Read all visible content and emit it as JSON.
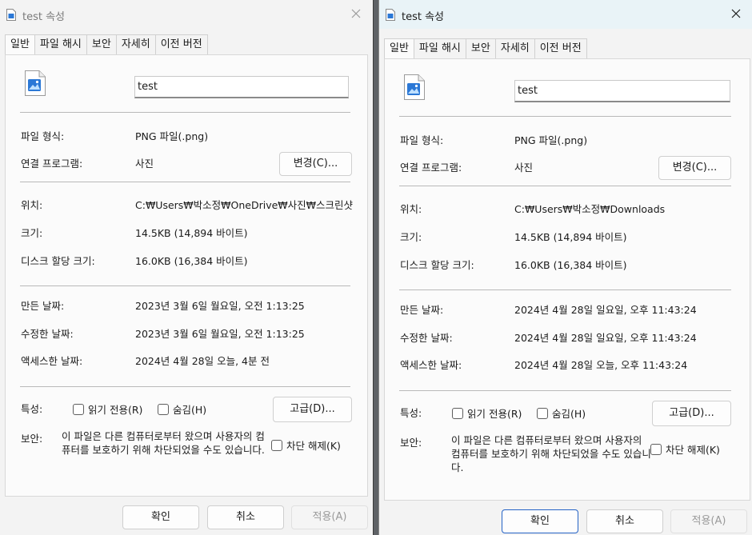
{
  "left": {
    "title": "test 속성",
    "tabs": [
      "일반",
      "파일 해시",
      "보안",
      "자세히",
      "이전 버전"
    ],
    "file_name": "test",
    "file_type_label": "파일 형식:",
    "file_type": "PNG 파일(.png)",
    "opens_with_label": "연결 프로그램:",
    "opens_with": "사진",
    "change_button": "변경(C)...",
    "location_label": "위치:",
    "location": "C:₩Users₩박소정₩OneDrive₩사진₩스크린샷",
    "size_label": "크기:",
    "size": "14.5KB (14,894 바이트)",
    "size_on_disk_label": "디스크 할당 크기:",
    "size_on_disk": "16.0KB (16,384 바이트)",
    "created_label": "만든 날짜:",
    "created": "2023년 3월 6일 월요일, 오전 1:13:25",
    "modified_label": "수정한 날짜:",
    "modified": "2023년 3월 6일 월요일, 오전 1:13:25",
    "accessed_label": "액세스한 날짜:",
    "accessed": "2024년 4월 28일 오늘, 4분 전",
    "attributes_label": "특성:",
    "readonly_label": "읽기 전용(R)",
    "hidden_label": "숨김(H)",
    "advanced_button": "고급(D)...",
    "security_label": "보안:",
    "security_text": "이 파일은 다른 컴퓨터로부터 왔으며 사용자의 컴퓨터를 보호하기 위해 차단되었을 수도 있습니다.",
    "unblock_label": "차단 해제(K)",
    "ok_button": "확인",
    "cancel_button": "취소",
    "apply_button": "적용(A)"
  },
  "right": {
    "title": "test 속성",
    "tabs": [
      "일반",
      "파일 해시",
      "보안",
      "자세히",
      "이전 버전"
    ],
    "file_name": "test",
    "file_type_label": "파일 형식:",
    "file_type": "PNG 파일(.png)",
    "opens_with_label": "연결 프로그램:",
    "opens_with": "사진",
    "change_button": "변경(C)...",
    "location_label": "위치:",
    "location": "C:₩Users₩박소정₩Downloads",
    "size_label": "크기:",
    "size": "14.5KB (14,894 바이트)",
    "size_on_disk_label": "디스크 할당 크기:",
    "size_on_disk": "16.0KB (16,384 바이트)",
    "created_label": "만든 날짜:",
    "created": "2024년 4월 28일 일요일, 오후 11:43:24",
    "modified_label": "수정한 날짜:",
    "modified": "2024년 4월 28일 일요일, 오후 11:43:24",
    "accessed_label": "액세스한 날짜:",
    "accessed": "2024년 4월 28일 오늘, 오후 11:43:24",
    "attributes_label": "특성:",
    "readonly_label": "읽기 전용(R)",
    "hidden_label": "숨김(H)",
    "advanced_button": "고급(D)...",
    "security_label": "보안:",
    "security_text": "이 파일은 다른 컴퓨터로부터 왔으며 사용자의 컴퓨터를 보호하기 위해 차단되었을 수도 있습니다.",
    "unblock_label": "차단 해제(K)",
    "ok_button": "확인",
    "cancel_button": "취소",
    "apply_button": "적용(A)"
  },
  "icons": {
    "app": "image-file-icon",
    "close": "close-icon",
    "file": "image-file-icon",
    "checkbox": "checkbox-icon"
  },
  "colors": {
    "accent": "#2563c6",
    "icon_blue": "#2b78d6"
  }
}
